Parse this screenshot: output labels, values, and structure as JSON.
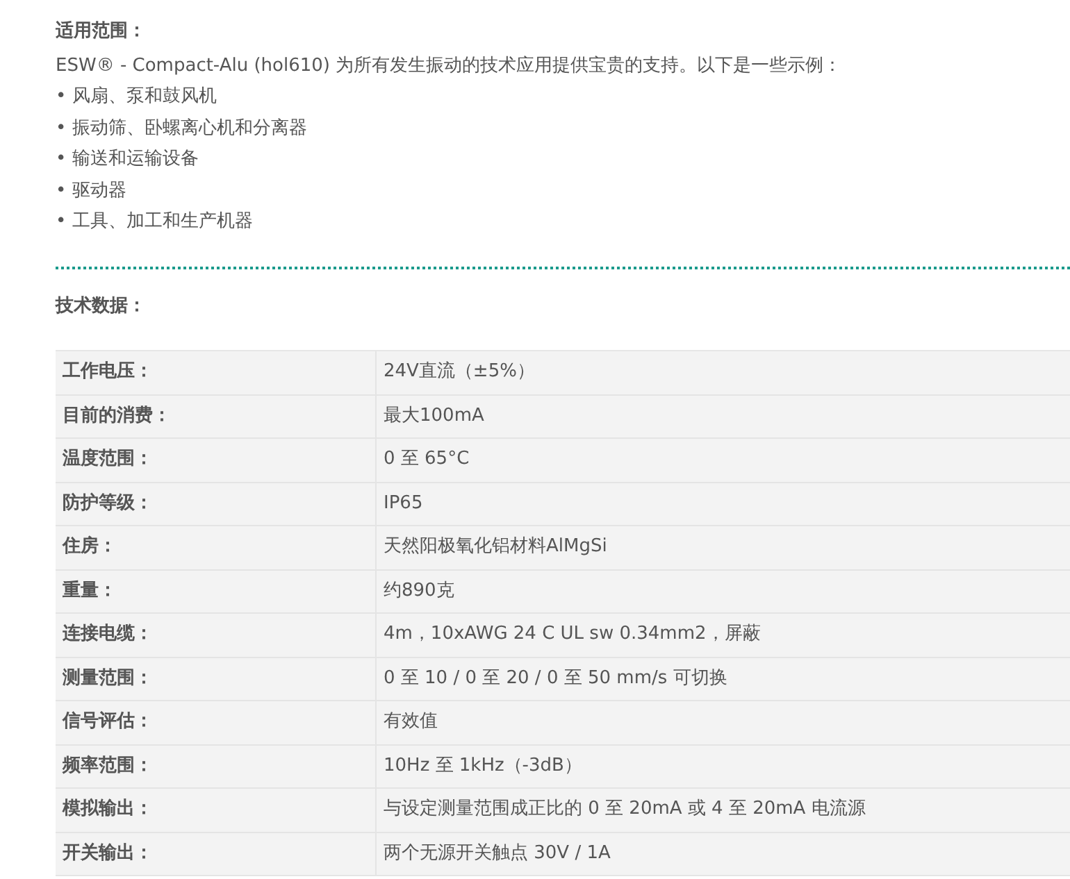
{
  "application": {
    "heading": "适用范围：",
    "intro": "ESW® - Compact-Alu (hol610) 为所有发生振动的技术应用提供宝贵的支持。以下是一些示例：",
    "examples": [
      "• 风扇、泵和鼓风机",
      "• 振动筛、卧螺离心机和分离器",
      "• 输送和运输设备",
      "• 驱动器",
      "• 工具、加工和生产机器"
    ]
  },
  "technical_data": {
    "heading": "技术数据：",
    "rows": [
      {
        "label": "工作电压：",
        "value": "24V直流（±5%）"
      },
      {
        "label": "目前的消费：",
        "value": "最大100mA"
      },
      {
        "label": "温度范围：",
        "value": "0 至 65°C"
      },
      {
        "label": "防护等级：",
        "value": "IP65"
      },
      {
        "label": "住房：",
        "value": "天然阳极氧化铝材料AlMgSi"
      },
      {
        "label": "重量：",
        "value": "约890克"
      },
      {
        "label": "连接电缆：",
        "value": "4m，10xAWG 24 C UL sw 0.34mm2，屏蔽"
      },
      {
        "label": "测量范围：",
        "value": "0 至 10 / 0 至 20 / 0 至 50 mm/s 可切换"
      },
      {
        "label": "信号评估：",
        "value": "有效值"
      },
      {
        "label": "频率范围：",
        "value": "10Hz 至 1kHz（-3dB）"
      },
      {
        "label": "模拟输出：",
        "value": "与设定测量范围成正比的 0 至 20mA 或 4 至 20mA 电流源"
      },
      {
        "label": "开关输出：",
        "value": "两个无源开关触点 30V / 1A"
      }
    ]
  }
}
